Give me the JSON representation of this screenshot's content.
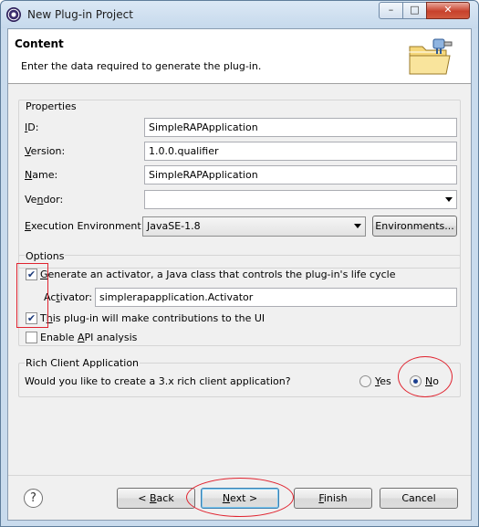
{
  "window": {
    "title": "New Plug-in Project"
  },
  "titlebar_buttons": {
    "minimize": "–",
    "maximize": "□",
    "close": "✕"
  },
  "header": {
    "title": "Content",
    "description": "Enter the data required to generate the plug-in."
  },
  "properties": {
    "group_title": "Properties",
    "id_label_first": "I",
    "id_label_rest": "D:",
    "id_value": "SimpleRAPApplication",
    "version_label_first": "V",
    "version_label_rest": "ersion:",
    "version_value": "1.0.0.qualifier",
    "name_label_first": "N",
    "name_label_rest": "ame:",
    "name_value": "SimpleRAPApplication",
    "vendor_label_first": "Ve",
    "vendor_label_mn": "n",
    "vendor_label_rest": "dor:",
    "vendor_value": "",
    "ee_label_first": "E",
    "ee_label_rest": "xecution Environment:",
    "ee_value": "JavaSE-1.8",
    "environments_button": "Environments..."
  },
  "options": {
    "group_title": "Options",
    "activator_check_mn": "G",
    "activator_check_rest": "enerate an activator, a Java class that controls the plug-in's life cycle",
    "activator_checked": true,
    "activator_label_pre": "Ac",
    "activator_label_mn": "t",
    "activator_label_rest": "ivator:",
    "activator_value": "simplerapapplication.Activator",
    "ui_check_pre": "T",
    "ui_check_mn": "h",
    "ui_check_rest": "is plug-in will make contributions to the UI",
    "ui_checked": true,
    "api_check_pre": "Enable ",
    "api_check_mn": "A",
    "api_check_rest": "PI analysis",
    "api_checked": false
  },
  "rich_client": {
    "group_title": "Rich Client Application",
    "question": "Would you like to create a 3.x rich client application?",
    "yes_mn": "Y",
    "yes_rest": "es",
    "no_mn": "N",
    "no_rest": "o",
    "selected": "No"
  },
  "footer": {
    "help_icon": "?",
    "back_mn": "B",
    "back_pre": "< ",
    "back_rest": "ack",
    "next_mn": "N",
    "next_rest": "ext >",
    "finish_mn": "F",
    "finish_rest": "inish",
    "cancel": "Cancel"
  },
  "icons": {
    "app": "eclipse-icon",
    "wizard": "plugin-folder-icon",
    "help": "help-icon"
  },
  "colors": {
    "annotation": "#e0232f",
    "radio_selected": "#1b3f8f"
  }
}
